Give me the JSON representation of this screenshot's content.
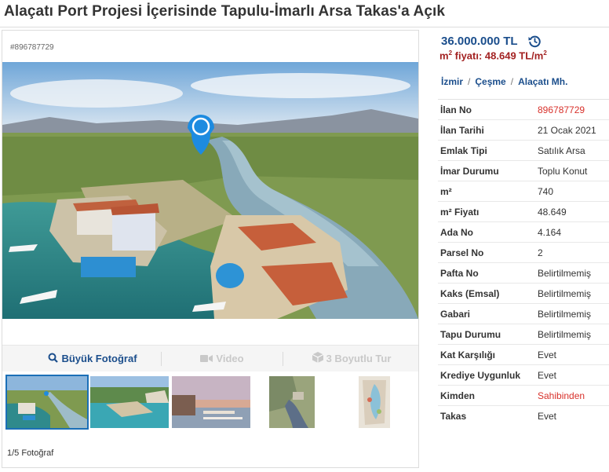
{
  "title": "Alaçatı Port Projesi İçerisinde Tapulu-İmarlı Arsa Takas'a Açık",
  "ad_number_tag": "#896787729",
  "price": "36.000.000 TL",
  "m2_price": {
    "label": "m",
    "sup": "2",
    "text": " fiyatı: 48.649 TL/m",
    "unit_sup": "2"
  },
  "breadcrumb": [
    "İzmir",
    "Çeşme",
    "Alaçatı Mh."
  ],
  "media_tabs": {
    "big_photo": "Büyük Fotoğraf",
    "video": "Video",
    "tour_3d": "3 Boyutlu Tur"
  },
  "photo_count": "1/5 Fotoğraf",
  "icons": {
    "search": "magnifier-icon",
    "video": "camera-icon",
    "cube": "cube-icon",
    "history": "history-icon",
    "map_pin": "location-pin-icon"
  },
  "colors": {
    "link_blue": "#1b4e8c",
    "price_red": "#a32222",
    "value_red": "#d8312b"
  },
  "details": [
    {
      "key": "İlan No",
      "value": "896787729",
      "highlight": true
    },
    {
      "key": "İlan Tarihi",
      "value": "21 Ocak 2021"
    },
    {
      "key": "Emlak Tipi",
      "value": "Satılık Arsa"
    },
    {
      "key": "İmar Durumu",
      "value": "Toplu Konut"
    },
    {
      "key": "m²",
      "value": "740"
    },
    {
      "key": "m² Fiyatı",
      "value": "48.649"
    },
    {
      "key": "Ada No",
      "value": "4.164"
    },
    {
      "key": "Parsel No",
      "value": "2"
    },
    {
      "key": "Pafta No",
      "value": "Belirtilmemiş"
    },
    {
      "key": "Kaks (Emsal)",
      "value": "Belirtilmemiş"
    },
    {
      "key": "Gabari",
      "value": "Belirtilmemiş"
    },
    {
      "key": "Tapu Durumu",
      "value": "Belirtilmemiş"
    },
    {
      "key": "Kat Karşılığı",
      "value": "Evet"
    },
    {
      "key": "Krediye Uygunluk",
      "value": "Evet"
    },
    {
      "key": "Kimden",
      "value": "Sahibinden",
      "highlight": true
    },
    {
      "key": "Takas",
      "value": "Evet"
    }
  ]
}
